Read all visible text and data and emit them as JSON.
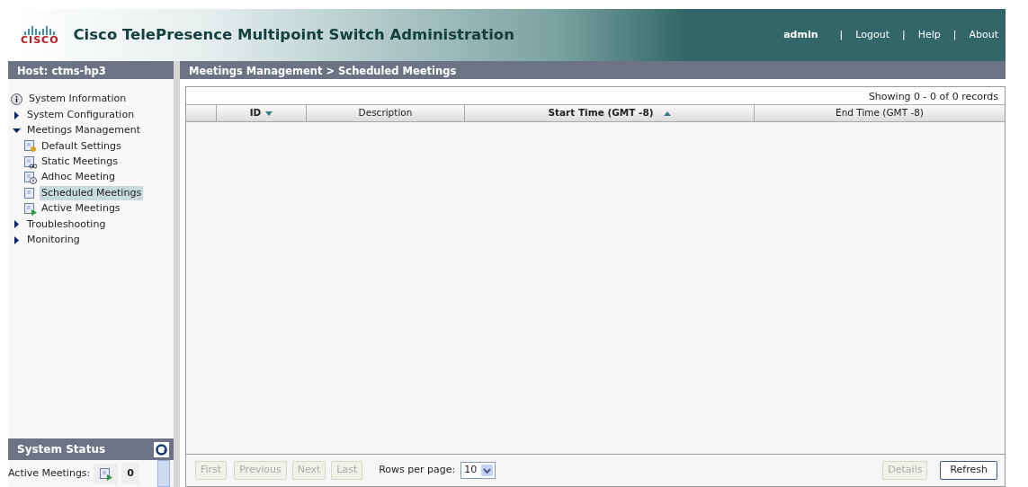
{
  "header": {
    "logo_text": "CISCO",
    "title": "Cisco TelePresence Multipoint Switch Administration",
    "user": "admin",
    "links": [
      {
        "separator": "|",
        "label": "Logout"
      },
      {
        "separator": "|",
        "label": "Help"
      },
      {
        "separator": "|",
        "label": "About"
      }
    ]
  },
  "host": "Host: ctms-hp3",
  "breadcrumb": "Meetings Management > Scheduled Meetings",
  "nav": [
    {
      "kind": "info",
      "label": "System Information"
    },
    {
      "kind": "folder",
      "label": "System Configuration",
      "expanded": false
    },
    {
      "kind": "folder",
      "label": "Meetings Management",
      "expanded": true,
      "children": [
        {
          "kind": "settings",
          "label": "Default Settings",
          "selected": false
        },
        {
          "kind": "static",
          "label": "Static Meetings",
          "selected": false
        },
        {
          "kind": "adhoc",
          "label": "Adhoc Meeting",
          "selected": false
        },
        {
          "kind": "scheduled",
          "label": "Scheduled Meetings",
          "selected": true
        },
        {
          "kind": "active",
          "label": "Active Meetings",
          "selected": false
        }
      ]
    },
    {
      "kind": "folder",
      "label": "Troubleshooting",
      "expanded": false
    },
    {
      "kind": "folder",
      "label": "Monitoring",
      "expanded": false
    }
  ],
  "system_status": {
    "title": "System Status",
    "rows": [
      {
        "label": "Active Meetings:",
        "value": "0"
      }
    ]
  },
  "table": {
    "summary": "Showing 0 - 0 of 0 records",
    "columns": [
      {
        "label": "ID",
        "sorted": true,
        "descending": true
      },
      {
        "label": "Description",
        "sorted": false
      },
      {
        "label": "Start Time (GMT -8)",
        "sorted": true,
        "descending": false
      },
      {
        "label": "End Time (GMT -8)",
        "sorted": false
      }
    ]
  },
  "pager": {
    "buttons": [
      {
        "label": "First",
        "disabled": true
      },
      {
        "label": "Previous",
        "disabled": true
      },
      {
        "label": "Next",
        "disabled": true
      },
      {
        "label": "Last",
        "disabled": true
      }
    ],
    "rows_label": "Rows per page:",
    "rows_value": "10"
  },
  "actions": [
    {
      "label": "Details",
      "disabled": true
    },
    {
      "label": "Refresh",
      "disabled": false
    }
  ]
}
